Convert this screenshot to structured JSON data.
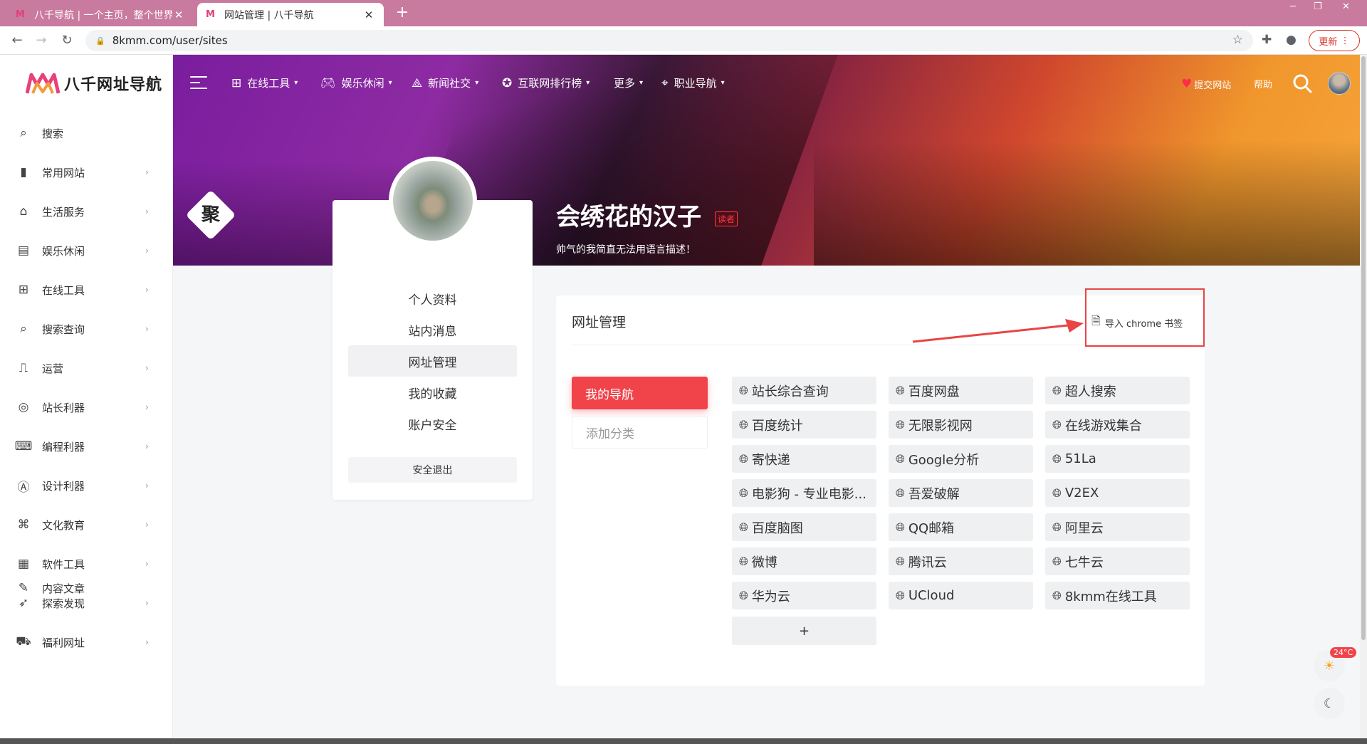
{
  "browser": {
    "tabs": [
      {
        "title": "八千导航 | 一个主页，整个世界",
        "active": false
      },
      {
        "title": "网站管理 | 八千导航",
        "active": true
      }
    ],
    "url": "8kmm.com/user/sites",
    "update_label": "更新"
  },
  "sidebar": {
    "logo_text": "八千网址导航",
    "items": [
      {
        "label": "搜索",
        "icon": "search-icon",
        "has_chevron": false
      },
      {
        "label": "常用网站",
        "icon": "bookmark-icon",
        "has_chevron": true
      },
      {
        "label": "生活服务",
        "icon": "home-heart-icon",
        "has_chevron": true
      },
      {
        "label": "娱乐休闲",
        "icon": "film-icon",
        "has_chevron": true
      },
      {
        "label": "在线工具",
        "icon": "grid-icon",
        "has_chevron": true
      },
      {
        "label": "搜索查询",
        "icon": "search-icon",
        "has_chevron": true
      },
      {
        "label": "运营",
        "icon": "chart-icon",
        "has_chevron": true
      },
      {
        "label": "站长利器",
        "icon": "www-icon",
        "has_chevron": true
      },
      {
        "label": "编程利器",
        "icon": "code-icon",
        "has_chevron": true
      },
      {
        "label": "设计利器",
        "icon": "design-icon",
        "has_chevron": true
      },
      {
        "label": "文化教育",
        "icon": "graduation-cap-icon",
        "has_chevron": true
      },
      {
        "label": "软件工具",
        "icon": "apps-icon",
        "has_chevron": true
      },
      {
        "label": "探索发现",
        "icon": "rocket-icon",
        "has_chevron": true
      },
      {
        "label": "福利网址",
        "icon": "car-icon",
        "has_chevron": true
      },
      {
        "label": "内容文章",
        "icon": "feather-icon",
        "has_chevron": false
      }
    ]
  },
  "topnav": {
    "items": [
      {
        "label": "在线工具",
        "icon": "grid-icon"
      },
      {
        "label": "娱乐休闲",
        "icon": "gamepad-icon"
      },
      {
        "label": "新闻社交",
        "icon": "share-icon"
      },
      {
        "label": "互联网排行榜",
        "icon": "rank-badge-icon"
      },
      {
        "label": "更多",
        "icon": ""
      },
      {
        "label": "职业导航",
        "icon": "location-pin-icon"
      }
    ],
    "submit_label": "提交网站",
    "help_label": "帮助"
  },
  "profile": {
    "name": "会绣花的汉子",
    "role": "读者",
    "bio": "帅气的我简直无法用语言描述！",
    "menu": [
      "个人资料",
      "站内消息",
      "网址管理",
      "我的收藏",
      "账户安全"
    ],
    "active_menu": "网址管理",
    "logout_label": "安全退出",
    "badge_char": "聚"
  },
  "main": {
    "title": "网址管理",
    "import_label": "导入 chrome 书签",
    "categories": [
      {
        "label": "我的导航",
        "active": true
      },
      {
        "label": "添加分类",
        "active": false
      }
    ],
    "sites": [
      "站长综合查询",
      "百度网盘",
      "超人搜索",
      "百度统计",
      "无限影视网",
      "在线游戏集合",
      "寄快递",
      "Google分析",
      "51La",
      "电影狗 - 专业电影...",
      "吾爱破解",
      "V2EX",
      "百度脑图",
      "QQ邮箱",
      "阿里云",
      "微博",
      "腾讯云",
      "七牛云",
      "华为云",
      "UCloud",
      "8kmm在线工具"
    ],
    "add_label": "+"
  },
  "widgets": {
    "temperature": "24°C"
  },
  "colors": {
    "accent": "#f0444a",
    "annotation": "#e84545"
  }
}
